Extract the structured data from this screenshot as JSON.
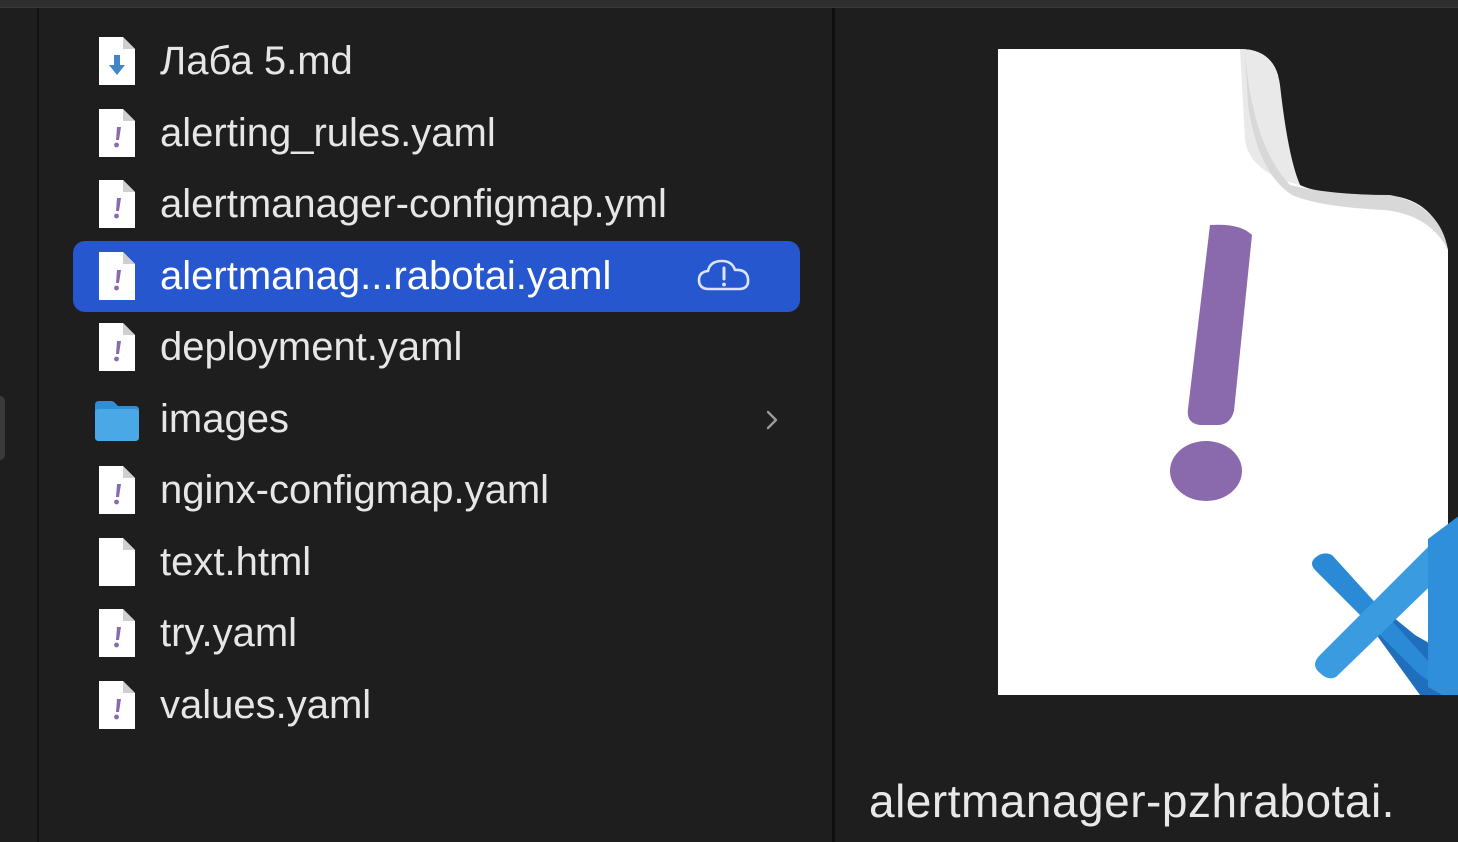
{
  "files": [
    {
      "name": "Лаба 5.md",
      "icon": "markdown-file-icon",
      "selected": false
    },
    {
      "name": "alerting_rules.yaml",
      "icon": "yaml-file-icon",
      "selected": false
    },
    {
      "name": "alertmanager-configmap.yml",
      "icon": "yaml-file-icon",
      "selected": false
    },
    {
      "name": "alertmanag...rabotai.yaml",
      "icon": "yaml-file-icon",
      "selected": true,
      "status_icon": "cloud-alert-icon"
    },
    {
      "name": "deployment.yaml",
      "icon": "yaml-file-icon",
      "selected": false
    },
    {
      "name": "images",
      "icon": "folder-icon",
      "selected": false,
      "disclosure_icon": "chevron-right-icon"
    },
    {
      "name": "nginx-configmap.yaml",
      "icon": "yaml-file-icon",
      "selected": false
    },
    {
      "name": "text.html",
      "icon": "blank-file-icon",
      "selected": false
    },
    {
      "name": "try.yaml",
      "icon": "yaml-file-icon",
      "selected": false
    },
    {
      "name": "values.yaml",
      "icon": "yaml-file-icon",
      "selected": false
    }
  ],
  "preview": {
    "filename": "alertmanager-pzhrabotai.",
    "icon": "yaml-document-preview-icon",
    "badge_icon": "vscode-icon"
  },
  "colors": {
    "background": "#1e1e1e",
    "selection": "#2757cf",
    "yaml_accent": "#8b69ad",
    "folder": "#4aa8e6",
    "vscode": "#2a8ad6"
  }
}
